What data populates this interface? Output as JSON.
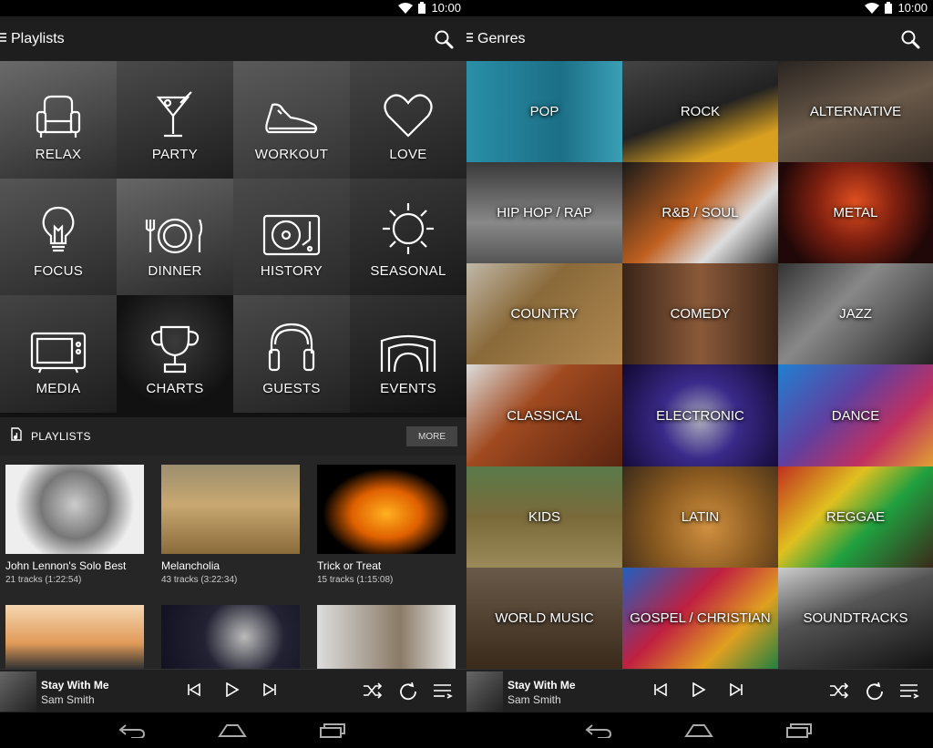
{
  "status": {
    "time": "10:00",
    "icons": [
      "wifi-icon",
      "battery-icon"
    ]
  },
  "left": {
    "title": "Playlists",
    "categories": [
      {
        "label": "RELAX",
        "icon": "armchair-icon"
      },
      {
        "label": "PARTY",
        "icon": "cocktail-icon"
      },
      {
        "label": "WORKOUT",
        "icon": "sneaker-icon"
      },
      {
        "label": "LOVE",
        "icon": "heart-icon"
      },
      {
        "label": "FOCUS",
        "icon": "lightbulb-icon"
      },
      {
        "label": "DINNER",
        "icon": "plate-icon"
      },
      {
        "label": "HISTORY",
        "icon": "turntable-icon"
      },
      {
        "label": "SEASONAL",
        "icon": "sun-icon"
      },
      {
        "label": "MEDIA",
        "icon": "tv-icon"
      },
      {
        "label": "CHARTS",
        "icon": "trophy-icon"
      },
      {
        "label": "GUESTS",
        "icon": "headphones-icon"
      },
      {
        "label": "EVENTS",
        "icon": "arch-icon"
      }
    ],
    "playlists_header": "PLAYLISTS",
    "more_label": "MORE",
    "playlists": [
      {
        "name": "John Lennon's Solo Best",
        "meta": "21 tracks (1:22:54)"
      },
      {
        "name": "Melancholia",
        "meta": "43 tracks (3:22:34)"
      },
      {
        "name": "Trick or Treat",
        "meta": "15 tracks (1:15:08)"
      }
    ]
  },
  "right": {
    "title": "Genres",
    "genres": [
      "POP",
      "ROCK",
      "ALTERNATIVE",
      "HIP HOP / RAP",
      "R&B / SOUL",
      "METAL",
      "COUNTRY",
      "COMEDY",
      "JAZZ",
      "CLASSICAL",
      "ELECTRONIC",
      "DANCE",
      "KIDS",
      "LATIN",
      "REGGAE",
      "WORLD MUSIC",
      "GOSPEL / CHRISTIAN",
      "SOUNDTRACKS"
    ]
  },
  "now_playing": {
    "song": "Stay With Me",
    "artist": "Sam Smith"
  },
  "colors": {
    "actionbar": "#1e1e1e",
    "background": "#111111",
    "now_playing_bar": "#202020"
  }
}
